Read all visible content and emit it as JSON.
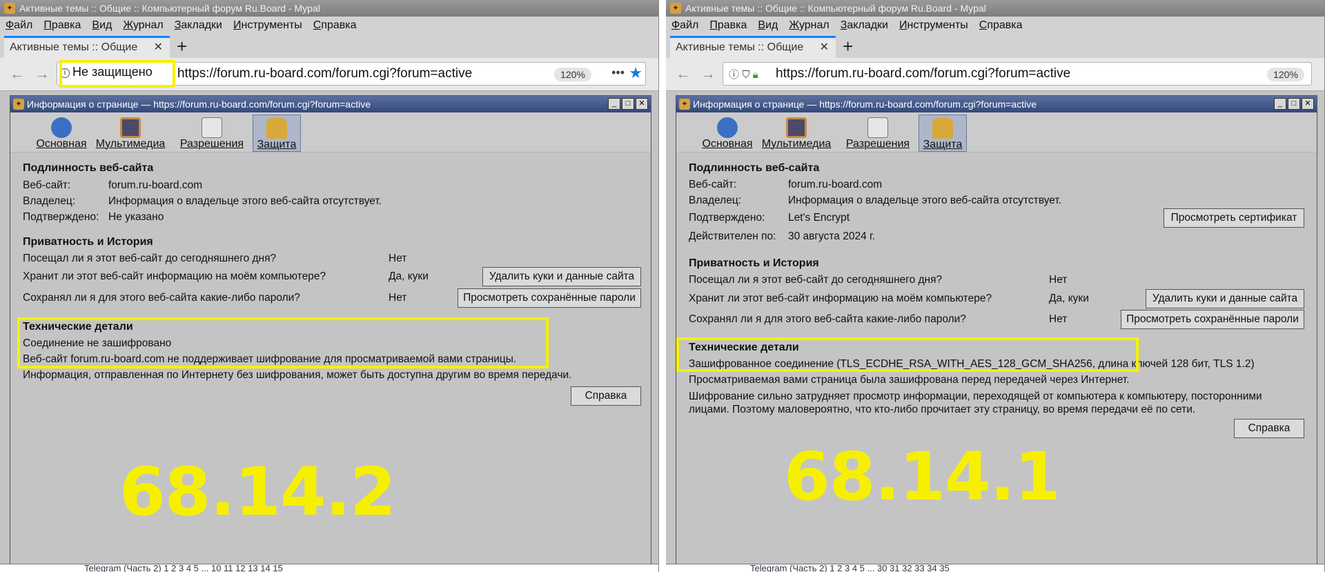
{
  "left": {
    "window_title": "Активные темы :: Общие :: Компьютерный форум Ru.Board - Mypal",
    "menu": [
      "Файл",
      "Правка",
      "Вид",
      "Журнал",
      "Закладки",
      "Инструменты",
      "Справка"
    ],
    "tab_label": "Активные темы :: Общие",
    "security_label": "Не защищено",
    "url": "https://forum.ru-board.com/forum.cgi?forum=active",
    "zoom": "120%",
    "dialog_title": "Информация о странице — https://forum.ru-board.com/forum.cgi?forum=active",
    "tools": [
      "Основная",
      "Мультимедиа",
      "Разрешения",
      "Защита"
    ],
    "identity": {
      "heading": "Подлинность веб-сайта",
      "website_label": "Веб-сайт:",
      "website_value": "forum.ru-board.com",
      "owner_label": "Владелец:",
      "owner_value": "Информация о владельце этого веб-сайта отсутствует.",
      "verified_label": "Подтверждено:",
      "verified_value": "Не указано"
    },
    "privacy": {
      "heading": "Приватность и История",
      "q1": "Посещал ли я этот веб-сайт до сегодняшнего дня?",
      "a1": "Нет",
      "q2": "Хранит ли этот веб-сайт информацию на моём компьютере?",
      "a2": "Да, куки",
      "btn_cookies": "Удалить куки и данные сайта",
      "q3": "Сохранял ли я для этого веб-сайта какие-либо пароли?",
      "a3": "Нет",
      "btn_passwords": "Просмотреть сохранённые пароли"
    },
    "tech": {
      "heading": "Технические детали",
      "line1": "Соединение не зашифровано",
      "line2": "Веб-сайт forum.ru-board.com не поддерживает шифрование для просматриваемой вами страницы.",
      "line3": "Информация, отправленная по Интернету без шифрования, может быть доступна другим во время передачи."
    },
    "help_button": "Справка",
    "version": "68.14.2",
    "bottom_text": "Telegram (Часть  2) 1 2 3 4 5 ... 10 11 12 13 14 15"
  },
  "right": {
    "window_title": "Активные темы :: Общие :: Компьютерный форум Ru.Board - Mypal",
    "menu": [
      "Файл",
      "Правка",
      "Вид",
      "Журнал",
      "Закладки",
      "Инструменты",
      "Справка"
    ],
    "tab_label": "Активные темы :: Общие",
    "url": "https://forum.ru-board.com/forum.cgi?forum=active",
    "zoom": "120%",
    "dialog_title": "Информация о странице — https://forum.ru-board.com/forum.cgi?forum=active",
    "tools": [
      "Основная",
      "Мультимедиа",
      "Разрешения",
      "Защита"
    ],
    "identity": {
      "heading": "Подлинность веб-сайта",
      "website_label": "Веб-сайт:",
      "website_value": "forum.ru-board.com",
      "owner_label": "Владелец:",
      "owner_value": "Информация о владельце этого веб-сайта отсутствует.",
      "verified_label": "Подтверждено:",
      "verified_value": "Let's Encrypt",
      "valid_label": "Действителен по:",
      "valid_value": "30 августа 2024 г.",
      "btn_cert": "Просмотреть сертификат"
    },
    "privacy": {
      "heading": "Приватность и История",
      "q1": "Посещал ли я этот веб-сайт до сегодняшнего дня?",
      "a1": "Нет",
      "q2": "Хранит ли этот веб-сайт информацию на моём компьютере?",
      "a2": "Да, куки",
      "btn_cookies": "Удалить куки и данные сайта",
      "q3": "Сохранял ли я для этого веб-сайта какие-либо пароли?",
      "a3": "Нет",
      "btn_passwords": "Просмотреть сохранённые пароли"
    },
    "tech": {
      "heading": "Технические детали",
      "line1": "Зашифрованное соединение (TLS_ECDHE_RSA_WITH_AES_128_GCM_SHA256, длина ключей 128 бит, TLS 1.2)",
      "line2": "Просматриваемая вами страница была зашифрована перед передачей через Интернет.",
      "line3": "Шифрование сильно затрудняет просмотр информации, переходящей от компьютера к компьютеру, посторонними",
      "line4": "лицами. Поэтому маловероятно, что кто-либо прочитает эту страницу, во время передачи её по сети."
    },
    "help_button": "Справка",
    "version": "68.14.1",
    "bottom_text": "Telegram (Часть  2) 1 2 3 4 5 ... 30 31 32 33 34 35"
  },
  "colors": {
    "highlight": "#f6f000",
    "dialog_title_bg": "#34487a",
    "dialog_bg": "#c4c4c4",
    "lock_green": "#22a32a",
    "star_blue": "#1a7ad9"
  }
}
